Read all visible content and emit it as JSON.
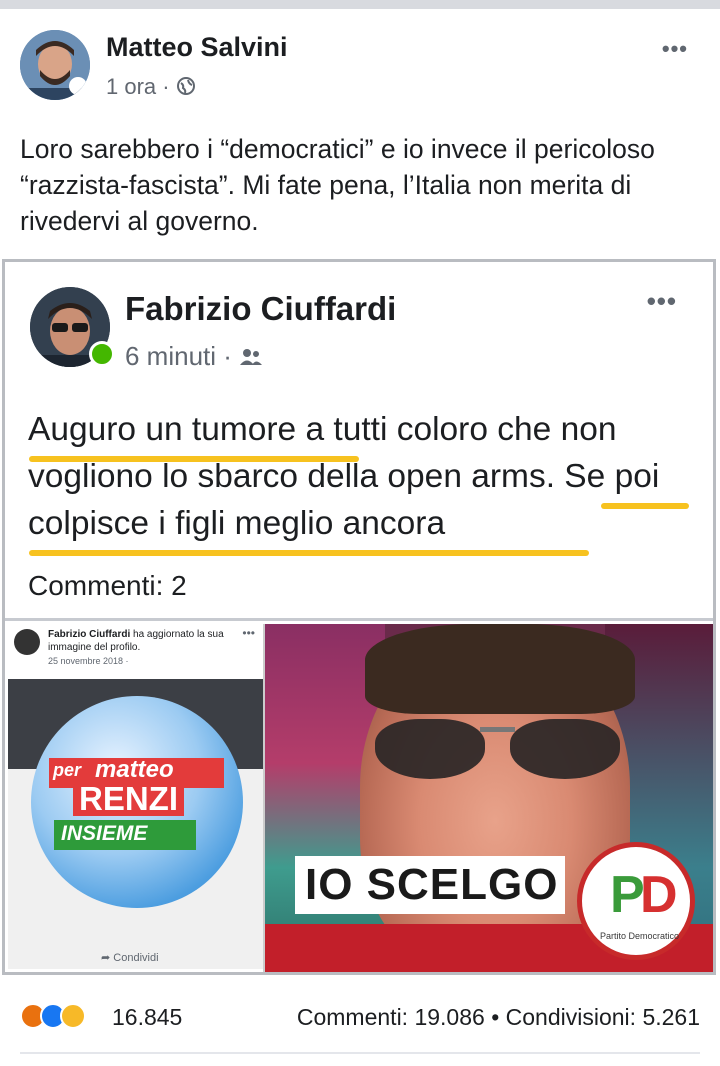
{
  "post": {
    "author": "Matteo Salvini",
    "time": "1 ora",
    "audience_icon": "globe-icon",
    "text": "Loro sarebbero i “democratici” e io invece il pericoloso “razzista-fascista”. Mi fate pena, l’Italia non merita di rivedervi al governo."
  },
  "shared": {
    "author": "Fabrizio Ciuffardi",
    "time": "6 minuti",
    "audience_icon": "friends-icon",
    "text": "Auguro un tumore a tutti coloro che non vogliono lo sbarco della open arms. Se poi colpisce i figli meglio ancora",
    "comments": "Commenti: 2",
    "mini_post": {
      "author": "Fabrizio Ciuffardi",
      "action": " ha aggiornato la sua immagine del profilo.",
      "date": "25 novembre 2018 ·",
      "share_label": "Condividi"
    },
    "profile_picture": {
      "per": "per",
      "matteo": "matteo",
      "renzi": "RENZI",
      "insieme": "INSIEME"
    },
    "photo": {
      "banner": "IO SCELGO",
      "logo_letters_p": "P",
      "logo_letters_d": "D",
      "logo_text": "Partito Democratico"
    }
  },
  "footer": {
    "reactions": [
      "angry-icon",
      "like-icon",
      "sad-icon"
    ],
    "reaction_count": "16.845",
    "comments": "Commenti: 19.086",
    "separator": "•",
    "shares": "Condivisioni: 5.261"
  },
  "colors": {
    "highlight": "#f7c21f",
    "online": "#44b700",
    "like": "#1877f2",
    "angry": "#e9710f"
  }
}
